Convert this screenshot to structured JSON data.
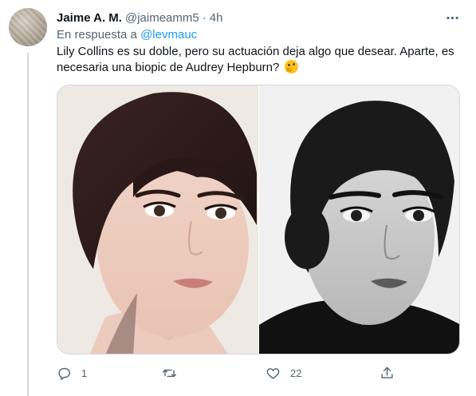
{
  "tweet": {
    "display_name": "Jaime A. M.",
    "handle": "@jaimeamm5",
    "separator": "·",
    "time": "4h",
    "reply_prefix": "En respuesta a",
    "reply_mention": "@levmauc",
    "text": "Lily Collins es su doble, pero su actuación deja algo que desear. Aparte, es necesaria una biopic de Audrey Hepburn?",
    "emoji": "thinking-face-emoji",
    "media": [
      {
        "description_icon": "portrait-photo-color"
      },
      {
        "description_icon": "portrait-photo-bw"
      }
    ],
    "actions": {
      "reply_count": "1",
      "retweet_count": "",
      "like_count": "22"
    }
  },
  "colors": {
    "accent": "#1d9bf0",
    "secondary_text": "#536471",
    "primary_text": "#0f1419",
    "border": "#cfd9de"
  }
}
